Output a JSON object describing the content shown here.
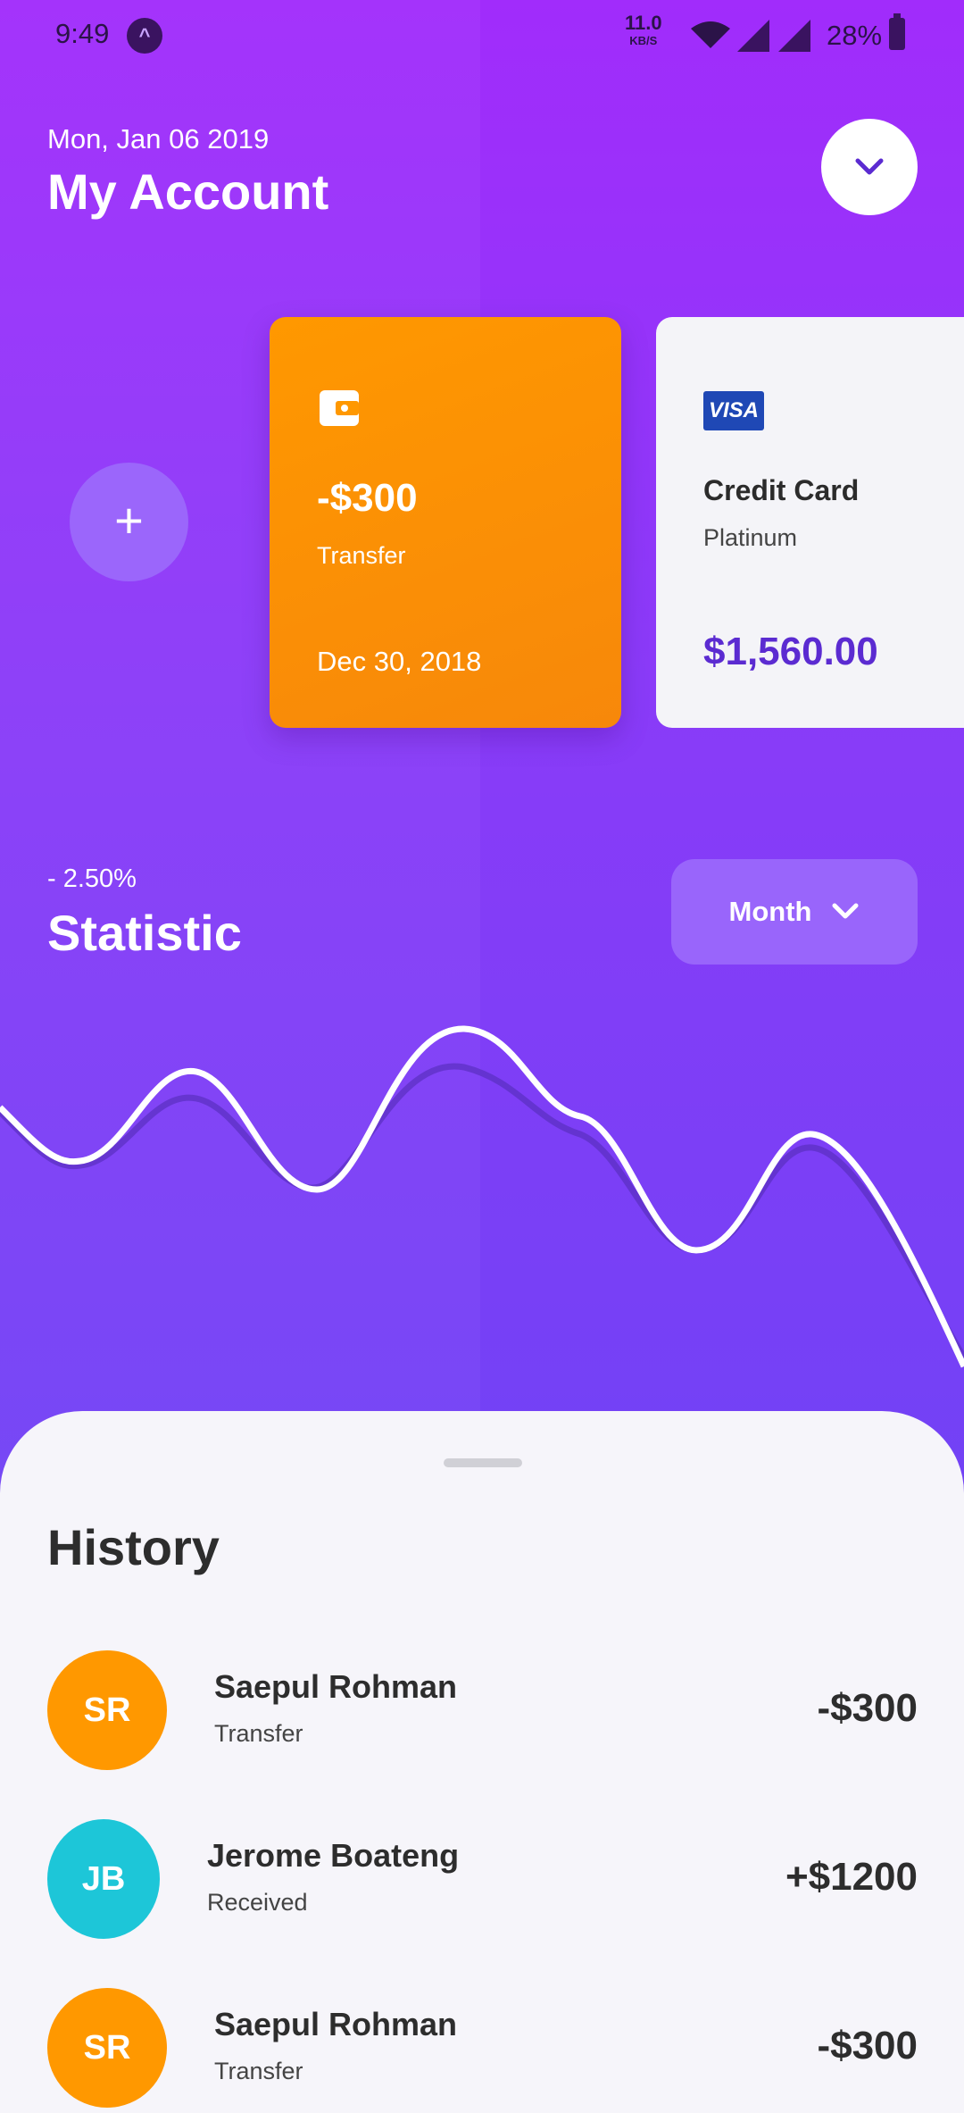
{
  "status_bar": {
    "time": "9:49",
    "net_speed": "11.0",
    "net_unit": "KB/S",
    "battery": "28%"
  },
  "header": {
    "date": "Mon, Jan 06 2019",
    "title": "My Account"
  },
  "cards": [
    {
      "amount": "-$300",
      "label": "Transfer",
      "date": "Dec 30, 2018",
      "icon": "wallet-icon",
      "color": "#ff9800"
    },
    {
      "brand": "VISA",
      "title": "Credit Card",
      "tier": "Platinum",
      "balance": "$1,560.00",
      "balance_color": "#5b2bd1"
    }
  ],
  "statistic": {
    "change": "- 2.50%",
    "title": "Statistic",
    "period": "Month"
  },
  "history": {
    "title": "History",
    "items": [
      {
        "initials": "SR",
        "name": "Saepul Rohman",
        "type": "Transfer",
        "amount": "-$300",
        "color": "#ff9800"
      },
      {
        "initials": "JB",
        "name": "Jerome Boateng",
        "type": "Received",
        "amount": "+$1200",
        "color": "#1dc6d8"
      },
      {
        "initials": "SR",
        "name": "Saepul Rohman",
        "type": "Transfer",
        "amount": "-$300",
        "color": "#ff9800"
      }
    ]
  },
  "colors": {
    "gradient_top": "#a12cfb",
    "gradient_bottom": "#7142f5",
    "accent": "#5b2bd1"
  }
}
